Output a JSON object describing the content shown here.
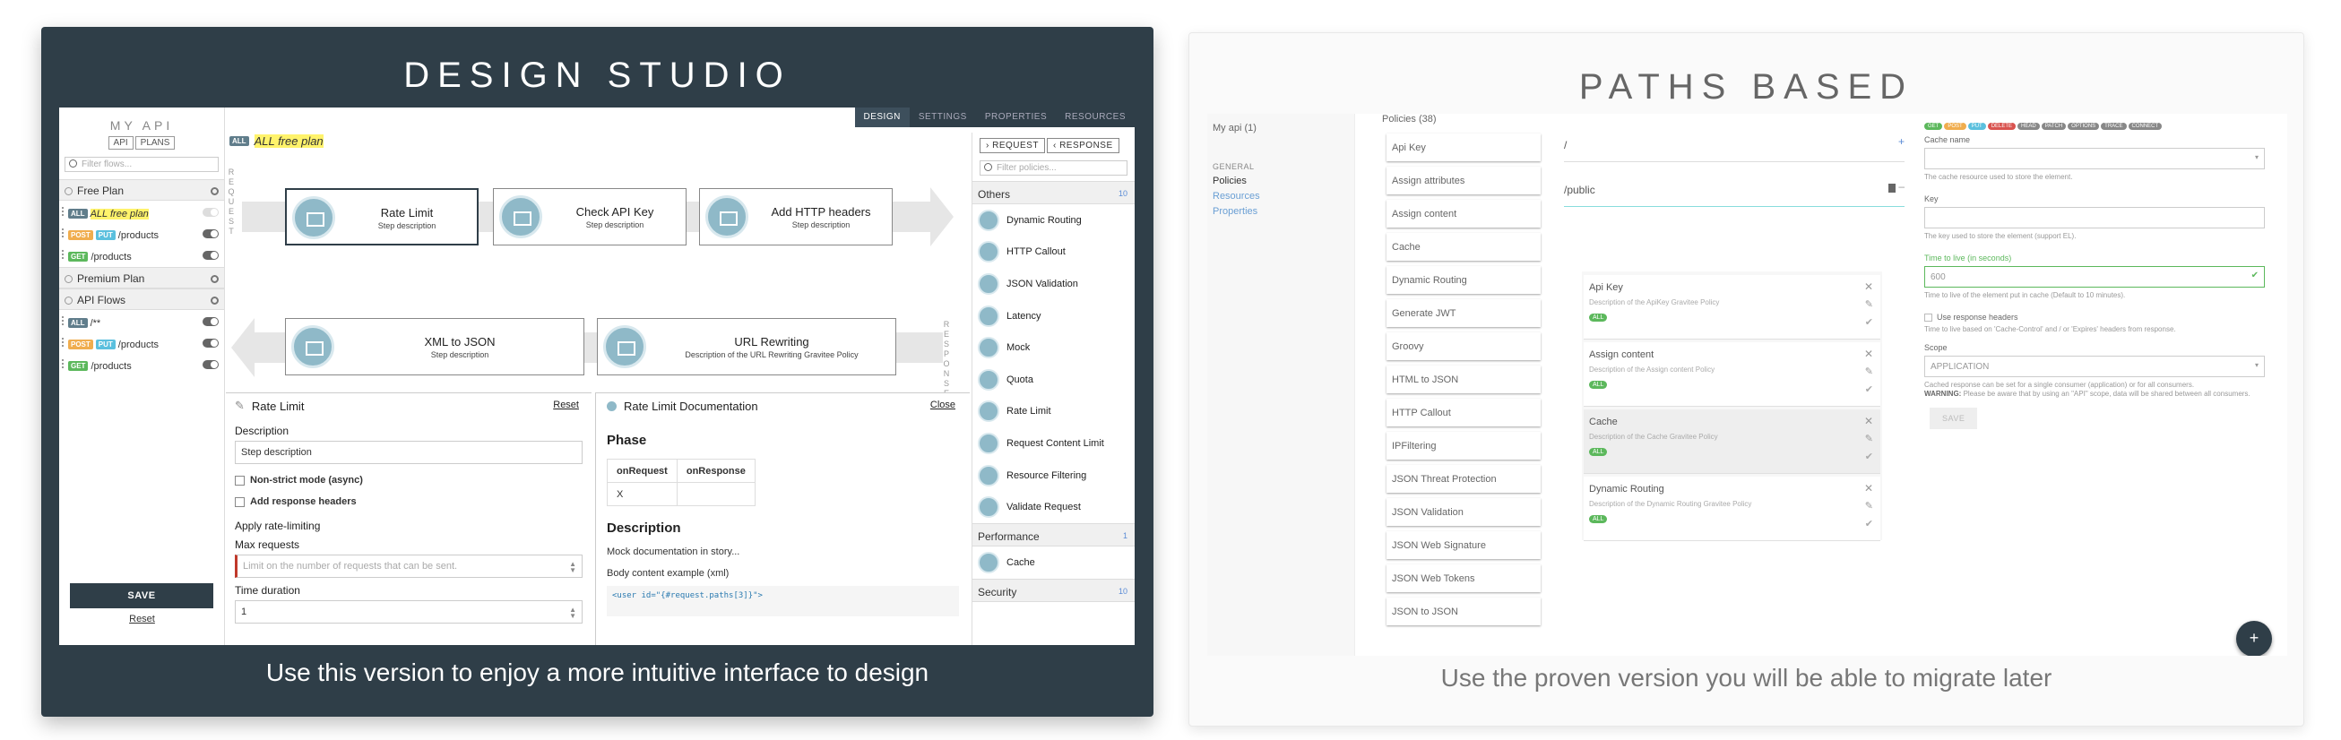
{
  "left_card": {
    "title": "DESIGN STUDIO",
    "caption": "Use this version to enjoy a more intuitive interface to design",
    "topbar_tabs": [
      "DESIGN",
      "SETTINGS",
      "PROPERTIES",
      "RESOURCES"
    ],
    "api_title": "MY API",
    "api_buttons": [
      "API",
      "PLANS"
    ],
    "filter_flows_placeholder": "Filter flows...",
    "plans": [
      {
        "name": "Free Plan"
      },
      {
        "name": "Premium Plan"
      },
      {
        "name": "API Flows"
      }
    ],
    "free_plan_flows": [
      {
        "methods": [
          "ALL"
        ],
        "path": "ALL free plan",
        "highlight": true,
        "enabled": false
      },
      {
        "methods": [
          "POST",
          "PUT"
        ],
        "path": "/products",
        "enabled": true
      },
      {
        "methods": [
          "GET"
        ],
        "path": "/products",
        "enabled": true
      }
    ],
    "api_flows": [
      {
        "methods": [
          "ALL"
        ],
        "path": "/**",
        "enabled": true
      },
      {
        "methods": [
          "POST",
          "PUT"
        ],
        "path": "/products",
        "enabled": true
      },
      {
        "methods": [
          "GET"
        ],
        "path": "/products",
        "enabled": true
      }
    ],
    "save_label": "SAVE",
    "reset_label": "Reset",
    "canvas_header": {
      "badge": "ALL",
      "name": "ALL free plan"
    },
    "request_label": "REQUEST",
    "response_label": "RESPONSE",
    "request_steps": [
      {
        "name": "Rate Limit",
        "desc": "Step description"
      },
      {
        "name": "Check API Key",
        "desc": "Step description"
      },
      {
        "name": "Add HTTP headers",
        "desc": "Step description"
      }
    ],
    "response_steps": [
      {
        "name": "XML to JSON",
        "desc": "Step description"
      },
      {
        "name": "URL Rewriting",
        "desc": "Description of the URL Rewriting Gravitee Policy"
      }
    ],
    "config": {
      "title": "Rate Limit",
      "reset": "Reset",
      "description_label": "Description",
      "description_value": "Step description",
      "check_nonstrict": "Non-strict mode (async)",
      "check_headers": "Add response headers",
      "apply_label": "Apply rate-limiting",
      "max_requests_label": "Max requests",
      "max_requests_placeholder": "Limit on the number of requests that can be sent.",
      "time_duration_label": "Time duration",
      "time_duration_value": "1"
    },
    "doc": {
      "title": "Rate Limit Documentation",
      "close": "Close",
      "phase_heading": "Phase",
      "col1": "onRequest",
      "col2": "onResponse",
      "cell1": "X",
      "cell2": "",
      "desc_heading": "Description",
      "mock_text": "Mock documentation in story...",
      "body_example": "Body content example (xml)",
      "code": "<user id=\"{#request.paths[3]}\">"
    },
    "policies": {
      "request_btn": "REQUEST",
      "response_btn": "RESPONSE",
      "filter_placeholder": "Filter policies...",
      "others_label": "Others",
      "others_count": "10",
      "others": [
        "Dynamic Routing",
        "HTTP Callout",
        "JSON Validation",
        "Latency",
        "Mock",
        "Quota",
        "Rate Limit",
        "Request Content Limit",
        "Resource Filtering",
        "Validate Request"
      ],
      "performance_label": "Performance",
      "performance_count": "1",
      "performance": [
        "Cache"
      ],
      "security_label": "Security",
      "security_count": "10"
    }
  },
  "right_card": {
    "title": "PATHS BASED",
    "caption": "Use the proven version you will be able to migrate later",
    "nav": {
      "api": "My api (1)",
      "group": "GENERAL",
      "items": [
        "Policies",
        "Resources",
        "Properties"
      ]
    },
    "policies_header": "Policies (38)",
    "policies": [
      "Api Key",
      "Assign attributes",
      "Assign content",
      "Cache",
      "Dynamic Routing",
      "Generate JWT",
      "Groovy",
      "HTML to JSON",
      "HTTP Callout",
      "IPFiltering",
      "JSON Threat Protection",
      "JSON Validation",
      "JSON Web Signature",
      "JSON Web Tokens",
      "JSON to JSON"
    ],
    "paths": [
      "/",
      "/public"
    ],
    "flow_policies": [
      {
        "name": "Api Key",
        "desc": "Description of the ApiKey Gravitee Policy",
        "badge": "ALL"
      },
      {
        "name": "Assign content",
        "desc": "Description of the Assign content Policy",
        "badge": "ALL"
      },
      {
        "name": "Cache",
        "desc": "Description of the Cache Gravitee Policy",
        "badge": "ALL"
      },
      {
        "name": "Dynamic Routing",
        "desc": "Description of the Dynamic Routing Gravitee Policy",
        "badge": "ALL"
      }
    ],
    "form": {
      "methods": [
        "GET",
        "POST",
        "PUT",
        "DELETE",
        "HEAD",
        "PATCH",
        "OPTIONS",
        "TRACE",
        "CONNECT"
      ],
      "cache_name_label": "Cache name",
      "cache_name_help": "The cache resource used to store the element.",
      "key_label": "Key",
      "key_help": "The key used to store the element (support EL).",
      "ttl_label": "Time to live (in seconds)",
      "ttl_value": "600",
      "ttl_help": "Time to live of the element put in cache (Default to 10 minutes).",
      "use_response_headers": "Use response headers",
      "response_headers_help": "Time to live based on 'Cache-Control' and / or 'Expires' headers from response.",
      "scope_label": "Scope",
      "scope_value": "APPLICATION",
      "scope_help": "Cached response can be set for a single consumer (application) or for all consumers.",
      "scope_warning_label": "WARNING:",
      "scope_warning": "Please be aware that by using an \"API\" scope, data will be shared between all consumers.",
      "save": "SAVE"
    },
    "fab": "+"
  }
}
